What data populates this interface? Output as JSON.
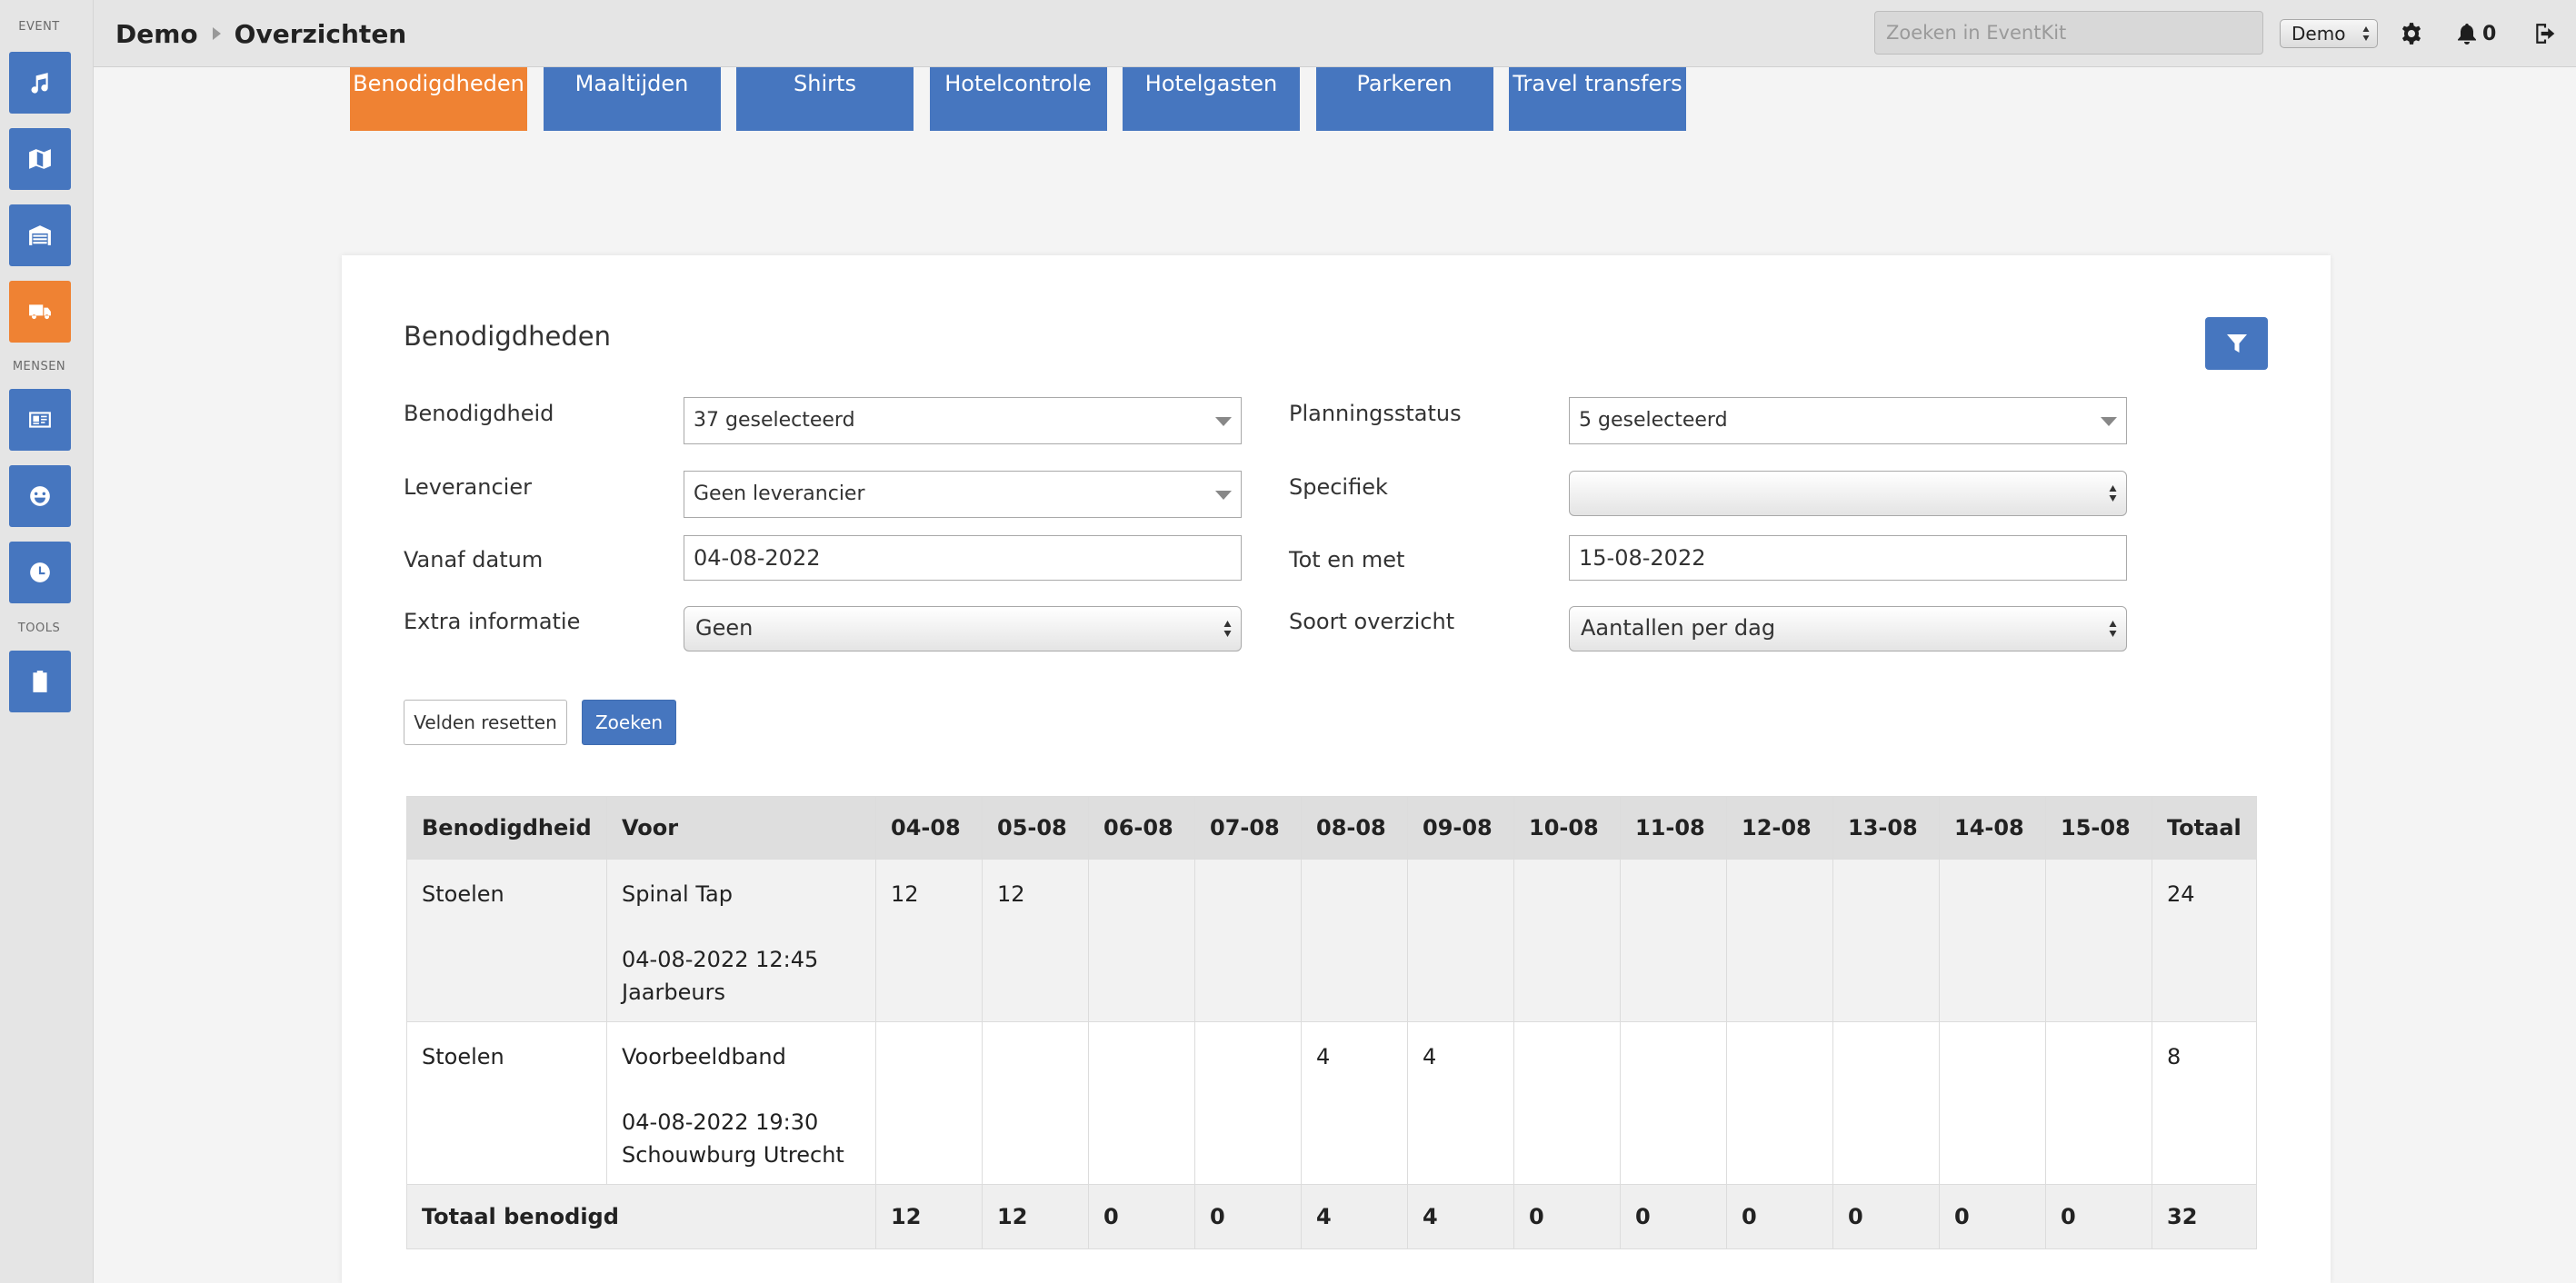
{
  "sidebar": {
    "sections": {
      "event": "EVENT",
      "mensen": "MENSEN",
      "tools": "TOOLS"
    },
    "items": [
      {
        "icon": "music-icon",
        "active": false
      },
      {
        "icon": "map-icon",
        "active": false
      },
      {
        "icon": "warehouse-icon",
        "active": false
      },
      {
        "icon": "truck-icon",
        "active": true
      },
      {
        "icon": "id-card-icon",
        "active": false
      },
      {
        "icon": "smiley-icon",
        "active": false
      },
      {
        "icon": "clock-icon",
        "active": false
      },
      {
        "icon": "clipboard-icon",
        "active": false
      }
    ]
  },
  "header": {
    "breadcrumb": [
      "Demo",
      "Overzichten"
    ],
    "search_placeholder": "Zoeken in EventKit",
    "event_select": "Demo",
    "notifications": "0"
  },
  "tabs": [
    {
      "label": "Benodigdheden",
      "active": true
    },
    {
      "label": "Maaltijden",
      "active": false
    },
    {
      "label": "Shirts",
      "active": false
    },
    {
      "label": "Hotelcontrole",
      "active": false
    },
    {
      "label": "Hotelgasten",
      "active": false
    },
    {
      "label": "Parkeren",
      "active": false
    },
    {
      "label": "Travel transfers",
      "active": false
    }
  ],
  "panel": {
    "title": "Benodigdheden",
    "filters": {
      "benodigdheid": {
        "label": "Benodigdheid",
        "value": "37 geselecteerd"
      },
      "planningsstatus": {
        "label": "Planningsstatus",
        "value": "5 geselecteerd"
      },
      "leverancier": {
        "label": "Leverancier",
        "value": "Geen leverancier"
      },
      "specifiek": {
        "label": "Specifiek",
        "value": ""
      },
      "vanaf": {
        "label": "Vanaf datum",
        "value": "04-08-2022"
      },
      "tot": {
        "label": "Tot en met",
        "value": "15-08-2022"
      },
      "extra": {
        "label": "Extra informatie",
        "value": "Geen"
      },
      "soort": {
        "label": "Soort overzicht",
        "value": "Aantallen per dag"
      }
    },
    "buttons": {
      "reset": "Velden resetten",
      "search": "Zoeken"
    }
  },
  "table": {
    "headers": [
      "Benodigdheid",
      "Voor",
      "04-08",
      "05-08",
      "06-08",
      "07-08",
      "08-08",
      "09-08",
      "10-08",
      "11-08",
      "12-08",
      "13-08",
      "14-08",
      "15-08",
      "Totaal"
    ],
    "rows": [
      {
        "item": "Stoelen",
        "voor_name": "Spinal Tap",
        "voor_datetime": "04-08-2022 12:45",
        "voor_location": "Jaarbeurs",
        "days": [
          "12",
          "12",
          "",
          "",
          "",
          "",
          "",
          "",
          "",
          "",
          "",
          ""
        ],
        "total": "24"
      },
      {
        "item": "Stoelen",
        "voor_name": "Voorbeeldband",
        "voor_datetime": "04-08-2022 19:30",
        "voor_location": "Schouwburg Utrecht",
        "days": [
          "",
          "",
          "",
          "",
          "4",
          "4",
          "",
          "",
          "",
          "",
          "",
          ""
        ],
        "total": "8"
      }
    ],
    "footer": {
      "label": "Totaal benodigd",
      "days": [
        "12",
        "12",
        "0",
        "0",
        "4",
        "4",
        "0",
        "0",
        "0",
        "0",
        "0",
        "0"
      ],
      "total": "32"
    }
  },
  "colors": {
    "primary": "#4676bf",
    "accent": "#ef8233",
    "sidebar_bg": "#e5e5e5",
    "page_bg": "#f4f4f4"
  }
}
